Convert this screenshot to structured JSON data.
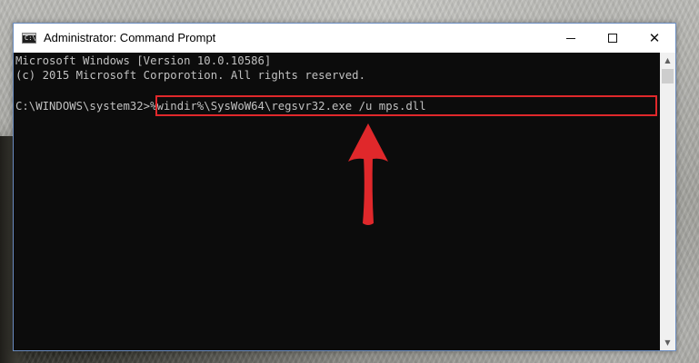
{
  "window": {
    "title": "Administrator: Command Prompt",
    "icon_name": "command-prompt-icon",
    "icon_glyph": "C:\\",
    "controls": {
      "minimize": "minimize",
      "maximize": "maximize",
      "close": "✕"
    }
  },
  "console": {
    "lines": [
      "Microsoft Windows [Version 10.0.10586]",
      "(c) 2015 Microsoft Corporotion. All rights reserved."
    ],
    "prompt": "C:\\WINDOWS\\system32>",
    "command": "%windir%\\SysWoW64\\regsvr32.exe /u mps.dll",
    "text_color": "#c0c0c0",
    "background_color": "#0c0c0c"
  },
  "annotation": {
    "highlight_color": "#e0282b",
    "arrow_color": "#e0282b",
    "arrow_icon": "red-arrow-up-icon"
  },
  "scrollbar": {
    "up_glyph": "▲",
    "down_glyph": "▼"
  }
}
